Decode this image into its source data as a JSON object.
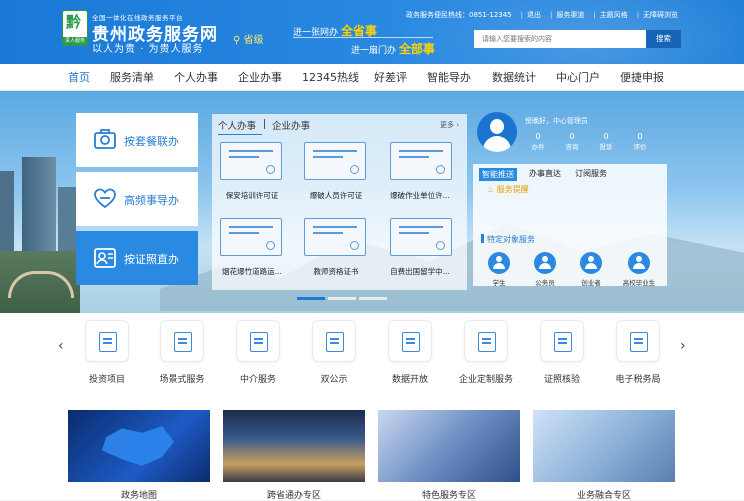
{
  "header": {
    "logo_mark": "黔",
    "logo_sub": "贵人服务",
    "platform_caption": "全国一体化在线政务服务平台",
    "site_title": "贵州政务服务网",
    "site_slogan": "以人为贵 · 为贵人服务",
    "region": "省级",
    "slogan_line1_prefix": "进一张网办",
    "slogan_line1_em": "全省事",
    "slogan_line2_prefix": "进一扇门办",
    "slogan_line2_em": "全部事",
    "hotline": "政务服务便民热线：0851-12345",
    "top_links": [
      "退出",
      "服务渠道",
      "主题风格",
      "无障碍浏览"
    ],
    "search_placeholder": "请输入您要搜索的内容",
    "search_button": "搜索"
  },
  "nav": {
    "items": [
      "首页",
      "服务清单",
      "个人办事",
      "企业办事",
      "12345热线",
      "好差评",
      "智能导办",
      "数据统计",
      "中心门户",
      "便捷申报"
    ],
    "active_index": 0
  },
  "banner": {
    "left_cards": [
      {
        "label": "按套餐联办",
        "icon": "package-icon"
      },
      {
        "label": "高频事导办",
        "icon": "heart-hand-icon"
      },
      {
        "label": "按证照直办",
        "icon": "license-icon"
      }
    ],
    "center_tabs": [
      "个人办事",
      "企业办事"
    ],
    "more_label": "更多 ›",
    "certificates": [
      "保安培训许可证",
      "爆破人员许可证",
      "爆破作业单位许...",
      "烟花爆竹道路运...",
      "教师资格证书",
      "自费出国留学中..."
    ],
    "carousel_dots": 3,
    "carousel_active": 0
  },
  "user_panel": {
    "greeting": "傍晚好，中心管理员",
    "stats": [
      {
        "value": "0",
        "label": "办件"
      },
      {
        "value": "0",
        "label": "咨询"
      },
      {
        "value": "0",
        "label": "投诉"
      },
      {
        "value": "0",
        "label": "评价"
      }
    ],
    "tabs": [
      "智能推送",
      "办事直达",
      "订阅服务"
    ],
    "reminder": "服务提醒",
    "target_title": "特定对象服务",
    "targets": [
      "学生",
      "公务员",
      "创业者",
      "高校毕业生"
    ]
  },
  "quick_services": [
    "投资项目",
    "场景式服务",
    "中介服务",
    "双公示",
    "数据开放",
    "企业定制服务",
    "证照核验",
    "电子税务局"
  ],
  "features": [
    "政务地图",
    "跨省通办专区",
    "特色服务专区",
    "业务融合专区"
  ],
  "colors": {
    "primary": "#1a78d6",
    "accent": "#ffd200",
    "highlight": "#e3a100"
  }
}
